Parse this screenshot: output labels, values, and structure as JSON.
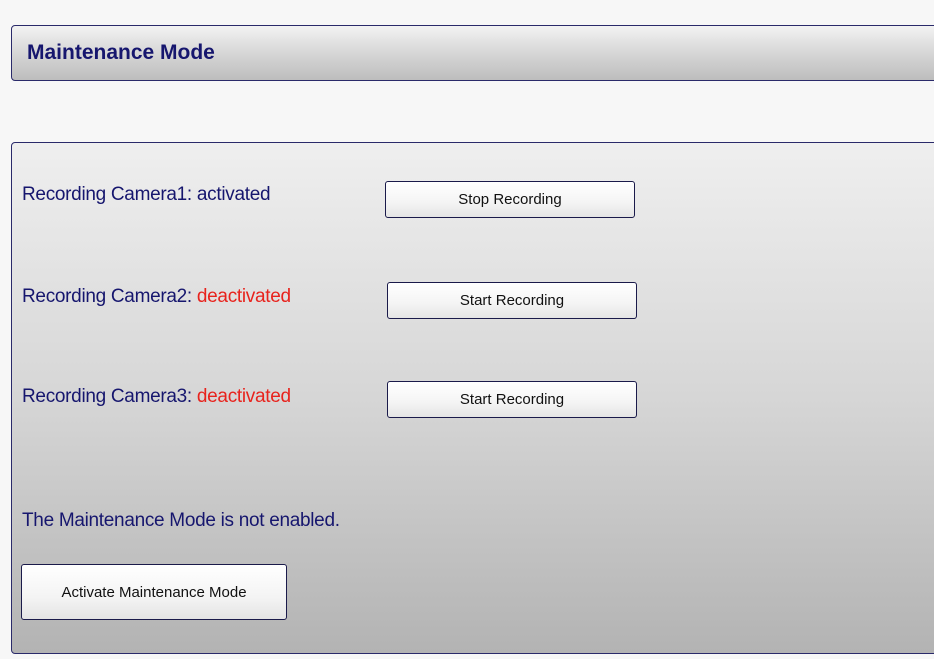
{
  "header": {
    "title": "Maintenance Mode"
  },
  "cameras": [
    {
      "label": "Recording Camera1: ",
      "status": "activated",
      "status_color": "#16166e",
      "button_label": "Stop Recording"
    },
    {
      "label": "Recording Camera2: ",
      "status": "deactivated",
      "status_color": "#e8231d",
      "button_label": "Start Recording"
    },
    {
      "label": "Recording Camera3: ",
      "status": "deactivated",
      "status_color": "#e8231d",
      "button_label": "Start Recording"
    }
  ],
  "maintenance": {
    "status_text": "The Maintenance Mode is not enabled.",
    "button_label": "Activate Maintenance Mode"
  },
  "colors": {
    "text_primary": "#16166e",
    "status_inactive": "#e8231d",
    "border": "#2a2a6a"
  }
}
